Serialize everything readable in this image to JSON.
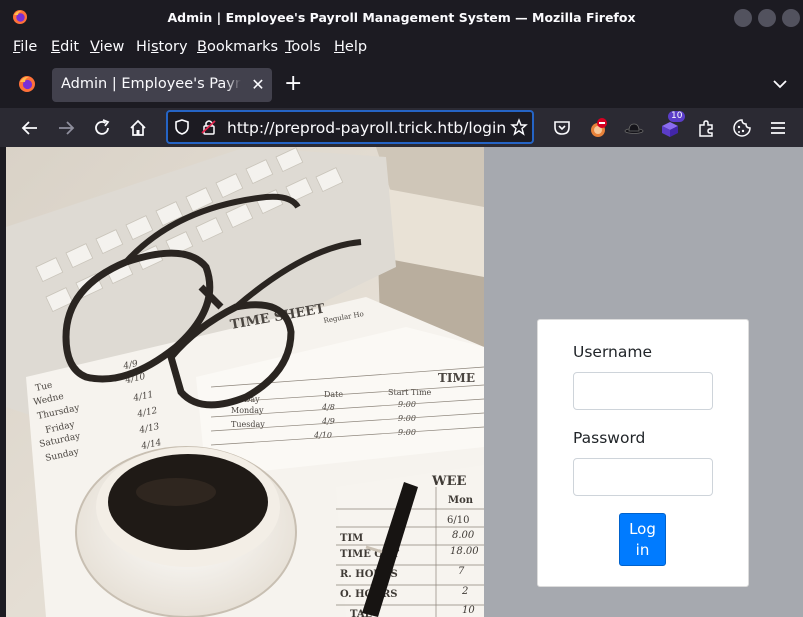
{
  "window": {
    "title": "Admin | Employee's Payroll Management System — Mozilla Firefox"
  },
  "menubar": {
    "items": [
      {
        "label": "File",
        "accel": "F",
        "rest": "ile"
      },
      {
        "label": "Edit",
        "accel": "E",
        "rest": "dit"
      },
      {
        "label": "View",
        "accel": "V",
        "rest": "iew"
      },
      {
        "label": "History",
        "pre": "Hi",
        "accel": "s",
        "rest": "tory"
      },
      {
        "label": "Bookmarks",
        "accel": "B",
        "rest": "ookmarks"
      },
      {
        "label": "Tools",
        "accel": "T",
        "rest": "ools"
      },
      {
        "label": "Help",
        "accel": "H",
        "rest": "elp"
      }
    ]
  },
  "tab": {
    "title": "Admin | Employee's Payroll Management System",
    "close": "✕"
  },
  "newtab": "+",
  "urlbar": {
    "url": "http://preprod-payroll.trick.htb/login.php"
  },
  "extensions": {
    "badge_count": "10"
  },
  "login": {
    "username_label": "Username",
    "username_value": "",
    "password_label": "Password",
    "password_value": "",
    "submit_label": "Log in"
  },
  "photo": {
    "sheet_title": "TIME SHEET",
    "col_regular": "Regular Ho",
    "header_time": "TIME",
    "col_day": "Day",
    "col_date": "Date",
    "col_start": "Start Time",
    "rows": [
      {
        "day": "Monday",
        "date": "4/8",
        "start": "9:00"
      },
      {
        "day": "Tuesday",
        "date": "4/9",
        "start": "9:00"
      },
      {
        "day": "",
        "date": "4/10",
        "start": "9:00"
      }
    ],
    "left_days": [
      "Tue",
      "Wedne",
      "Thursday",
      "Friday",
      "Saturday",
      "Sunday"
    ],
    "left_dates": [
      "4/9",
      "4/10",
      "4/11",
      "4/12",
      "4/13",
      "4/14"
    ],
    "week_title": "WEE",
    "week_col": "Mon",
    "week_vals": [
      "6/10",
      "8.00",
      "18.00",
      "7",
      "2",
      "10"
    ],
    "week_labels": [
      "TIM",
      "TIME OUT",
      "R. HOURS",
      "O. HOURS",
      "TAL"
    ]
  }
}
